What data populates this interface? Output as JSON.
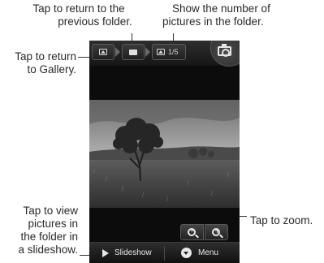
{
  "callouts": {
    "previous_folder": [
      "Tap to return to the",
      "previous folder."
    ],
    "picture_count": [
      "Show the number of",
      "pictures in the folder."
    ],
    "gallery": [
      "Tap to return",
      "to Gallery."
    ],
    "slideshow": [
      "Tap to view",
      "pictures in",
      "the folder in",
      "a slideshow."
    ],
    "zoom": "Tap to zoom."
  },
  "phone": {
    "counter": "1/5",
    "slideshow_label": "Slideshow",
    "menu_label": "Menu",
    "zoom_out_sign": "−",
    "zoom_in_sign": "+"
  },
  "icons": [
    "gallery-icon",
    "folder-icon",
    "picture-icon",
    "camera-icon",
    "zoom-out-icon",
    "zoom-in-icon",
    "play-icon",
    "menu-icon"
  ],
  "colors": {
    "screen_background": "#0c0c0c",
    "bar_background": "#1e1e1e",
    "icon_color": "#e6e6e6"
  }
}
